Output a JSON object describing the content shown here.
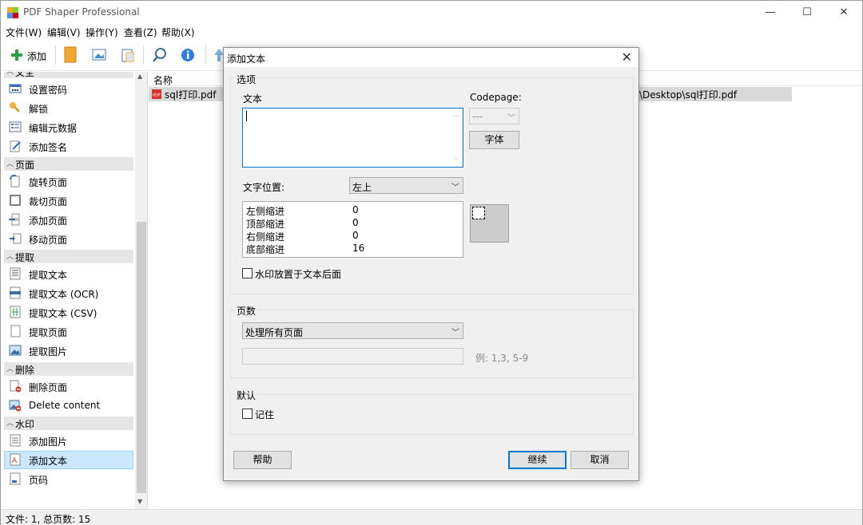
{
  "app": {
    "title": "PDF Shaper Professional",
    "window_controls": {
      "minimize": "—",
      "maximize": "☐",
      "close": "✕"
    }
  },
  "menu": [
    "文件(W)",
    "编辑(V)",
    "操作(Y)",
    "查看(Z)",
    "帮助(X)"
  ],
  "toolbar": {
    "add_label": "添加",
    "icons": [
      "plus-icon",
      "bookmark-icon",
      "image-icon",
      "clipboard-icon",
      "search-icon",
      "info-icon",
      "upload-icon"
    ]
  },
  "sidebar": {
    "partial_top_label": "文全",
    "groups": [
      {
        "label": "",
        "items": [
          {
            "label": "设置密码",
            "icon": "password-icon"
          },
          {
            "label": "解锁",
            "icon": "key-icon"
          },
          {
            "label": "编辑元数据",
            "icon": "metadata-icon"
          },
          {
            "label": "添加签名",
            "icon": "signature-icon"
          }
        ]
      },
      {
        "label": "页面",
        "items": [
          {
            "label": "旋转页面",
            "icon": "rotate-page-icon"
          },
          {
            "label": "裁切页面",
            "icon": "crop-page-icon"
          },
          {
            "label": "添加页面",
            "icon": "add-page-icon"
          },
          {
            "label": "移动页面",
            "icon": "move-page-icon"
          }
        ]
      },
      {
        "label": "提取",
        "items": [
          {
            "label": "提取文本",
            "icon": "extract-text-icon"
          },
          {
            "label": "提取文本 (OCR)",
            "icon": "ocr-icon"
          },
          {
            "label": "提取文本 (CSV)",
            "icon": "csv-icon"
          },
          {
            "label": "提取页面",
            "icon": "extract-page-icon"
          },
          {
            "label": "提取图片",
            "icon": "extract-image-icon"
          }
        ]
      },
      {
        "label": "删除",
        "items": [
          {
            "label": "删除页面",
            "icon": "delete-page-icon"
          },
          {
            "label": "Delete content",
            "icon": "delete-content-icon"
          }
        ]
      },
      {
        "label": "水印",
        "items": [
          {
            "label": "添加图片",
            "icon": "add-image-icon"
          },
          {
            "label": "添加文本",
            "icon": "add-text-icon",
            "selected": true
          },
          {
            "label": "页码",
            "icon": "page-number-icon"
          }
        ]
      }
    ]
  },
  "filelist": {
    "column_name": "名称",
    "file_name": "sql打印.pdf",
    "file_path_tail": "\\Desktop\\sql打印.pdf"
  },
  "status": "文件: 1, 总页数: 15",
  "dialog": {
    "title": "添加文本",
    "close": "✕",
    "options_legend": "选项",
    "text_label": "文本",
    "text_value": "",
    "codepage_label": "Codepage:",
    "codepage_value": "---",
    "font_button": "字体",
    "position_label": "文字位置:",
    "position_value": "左上",
    "indents": [
      {
        "label": "左侧缩进",
        "value": "0"
      },
      {
        "label": "顶部缩进",
        "value": "0"
      },
      {
        "label": "右侧缩进",
        "value": "0"
      },
      {
        "label": "底部缩进",
        "value": "16"
      }
    ],
    "watermark_behind_label": "水印放置于文本后面",
    "watermark_behind_checked": false,
    "pages_legend": "页数",
    "pages_value": "处理所有页面",
    "pages_range_value": "",
    "pages_hint": "例: 1,3, 5-9",
    "default_legend": "默认",
    "remember_label": "记住",
    "remember_checked": false,
    "help_button": "帮助",
    "continue_button": "继续",
    "cancel_button": "取消"
  }
}
